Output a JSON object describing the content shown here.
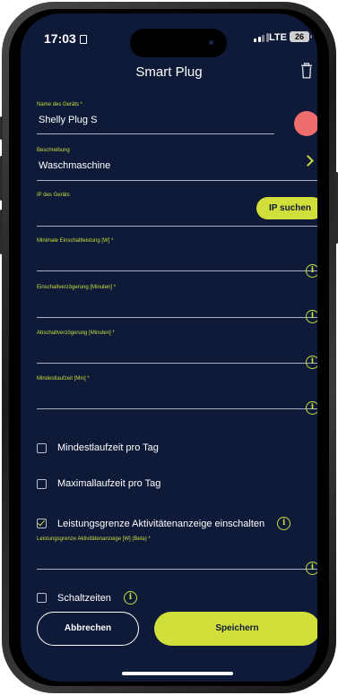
{
  "status_bar": {
    "time": "17:03",
    "network": "LTE",
    "battery": "26"
  },
  "header": {
    "title": "Smart Plug"
  },
  "fields": [
    {
      "label": "Name des Geräts *",
      "value": "Shelly Plug S"
    },
    {
      "label": "Beschreibung",
      "value": "Waschmaschine"
    },
    {
      "label": "IP des Geräts",
      "value": ""
    },
    {
      "label": "Minimale Einschaltleistung [W] *",
      "value": ""
    },
    {
      "label": "Einschaltverzögerung [Minuten] *",
      "value": ""
    },
    {
      "label": "Abschaltverzögerung [Minuten] *",
      "value": ""
    },
    {
      "label": "Mindestlaufzeit [Min] *",
      "value": ""
    },
    {
      "label": "Leistungsgrenze Aktivitätenanzeige [W] (Beta) *",
      "value": ""
    }
  ],
  "ip_search_label": "IP suchen",
  "device_color": "#ef6d6d",
  "checkboxes": [
    {
      "label": "Mindestlaufzeit pro Tag",
      "checked": false
    },
    {
      "label": "Maximallaufzeit pro Tag",
      "checked": false
    },
    {
      "label": "Leistungsgrenze Aktivitätenanzeige einschalten",
      "checked": true
    },
    {
      "label": "Schaltzeiten",
      "checked": false
    }
  ],
  "info_icon_glyph": "i",
  "buttons": {
    "cancel": "Abbrechen",
    "save": "Speichern"
  },
  "colors": {
    "background": "#0f1a38",
    "accent": "#d1df3b",
    "label": "#c9df3f"
  }
}
